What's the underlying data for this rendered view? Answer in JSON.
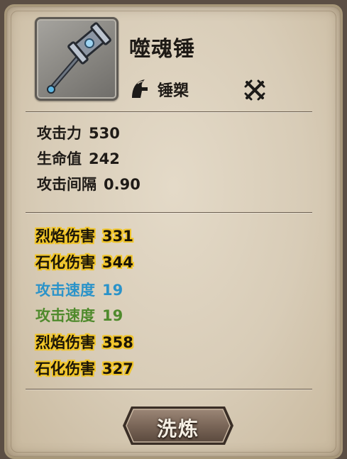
{
  "item": {
    "name": "噬魂锤",
    "type_label": "锤槊",
    "type_icon": "helmet-crest-icon",
    "slot_icon": "crossed-swords-icon",
    "image_icon": "soul-hammer-icon"
  },
  "base_stats": [
    {
      "label": "攻击力",
      "value": "530"
    },
    {
      "label": "生命值",
      "value": "242"
    },
    {
      "label": "攻击间隔",
      "value": "0.90"
    }
  ],
  "affixes": [
    {
      "label": "烈焰伤害",
      "value": "331",
      "color": "gold"
    },
    {
      "label": "石化伤害",
      "value": "344",
      "color": "gold"
    },
    {
      "label": "攻击速度",
      "value": "19",
      "color": "blue"
    },
    {
      "label": "攻击速度",
      "value": "19",
      "color": "green"
    },
    {
      "label": "烈焰伤害",
      "value": "358",
      "color": "gold"
    },
    {
      "label": "石化伤害",
      "value": "327",
      "color": "gold"
    }
  ],
  "colors": {
    "gold_outline": "#f0c52a",
    "blue": "#2b93c9",
    "green": "#4f8a2c",
    "panel": "#dcd1bd"
  },
  "actions": {
    "refine_label": "洗炼"
  }
}
